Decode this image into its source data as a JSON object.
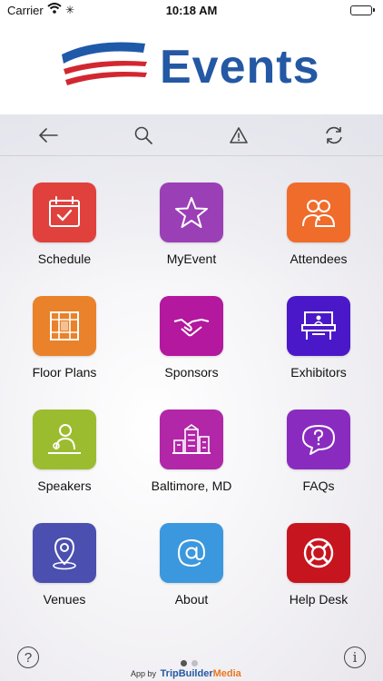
{
  "status_bar": {
    "carrier": "Carrier",
    "time": "10:18 AM",
    "battery_level": 1.0
  },
  "brand": {
    "title": "Events",
    "colors": {
      "title": "#2458a4",
      "flag_blue": "#1f5aa8",
      "flag_red": "#d22730"
    }
  },
  "toolbar": {
    "items": [
      {
        "icon": "back-arrow-icon"
      },
      {
        "icon": "search-icon"
      },
      {
        "icon": "alert-icon"
      },
      {
        "icon": "refresh-icon"
      }
    ]
  },
  "grid": {
    "tiles": [
      {
        "label": "Schedule",
        "icon": "calendar-check-icon",
        "color": "#e0413d"
      },
      {
        "label": "MyEvent",
        "icon": "star-icon",
        "color": "#9b3fb6"
      },
      {
        "label": "Attendees",
        "icon": "people-icon",
        "color": "#ef6c2b"
      },
      {
        "label": "Floor Plans",
        "icon": "floor-plan-icon",
        "color": "#e9822a"
      },
      {
        "label": "Sponsors",
        "icon": "handshake-icon",
        "color": "#b3189e"
      },
      {
        "label": "Exhibitors",
        "icon": "booth-icon",
        "color": "#4b18c9"
      },
      {
        "label": "Speakers",
        "icon": "speaker-icon",
        "color": "#9cbc2f"
      },
      {
        "label": "Baltimore, MD",
        "icon": "city-icon",
        "color": "#b226a8"
      },
      {
        "label": "FAQs",
        "icon": "question-bubble-icon",
        "color": "#8a2bc0"
      },
      {
        "label": "Venues",
        "icon": "map-pin-icon",
        "color": "#4b4fb0"
      },
      {
        "label": "About",
        "icon": "at-icon",
        "color": "#3b98de"
      },
      {
        "label": "Help Desk",
        "icon": "lifebuoy-icon",
        "color": "#c7151f"
      }
    ]
  },
  "footer": {
    "help_glyph": "?",
    "info_glyph": "i",
    "credit_prefix": "App by",
    "credit_brand": "TripBuilder",
    "credit_brand_suffix": "Media",
    "pager": {
      "pages": 2,
      "current": 1
    }
  }
}
